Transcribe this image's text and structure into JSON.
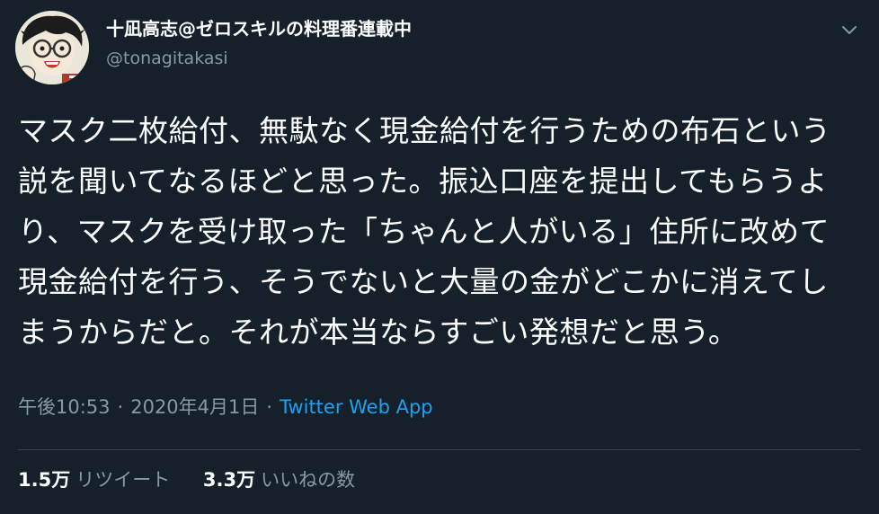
{
  "user": {
    "display_name": "十凪高志@ゼロスキルの料理番連載中",
    "handle": "@tonagitakasi",
    "avatar_icon": "avatar-illustration"
  },
  "tweet": {
    "text": "マスク二枚給付、無駄なく現金給付を行うための布石という説を聞いてなるほどと思った。振込口座を提出してもらうより、マスクを受け取った「ちゃんと人がいる」住所に改めて現金給付を行う、そうでないと大量の金がどこかに消えてしまうからだと。それが本当ならすごい発想だと思う。"
  },
  "meta": {
    "time": "午後10:53",
    "separator": "·",
    "date": "2020年4月1日",
    "source": "Twitter Web App"
  },
  "stats": {
    "retweets_count": "1.5万",
    "retweets_label": "リツイート",
    "likes_count": "3.3万",
    "likes_label": "いいねの数"
  },
  "colors": {
    "background": "#15202b",
    "secondary_text": "#8899a6",
    "link": "#1da1f2",
    "divider": "#38444d"
  }
}
